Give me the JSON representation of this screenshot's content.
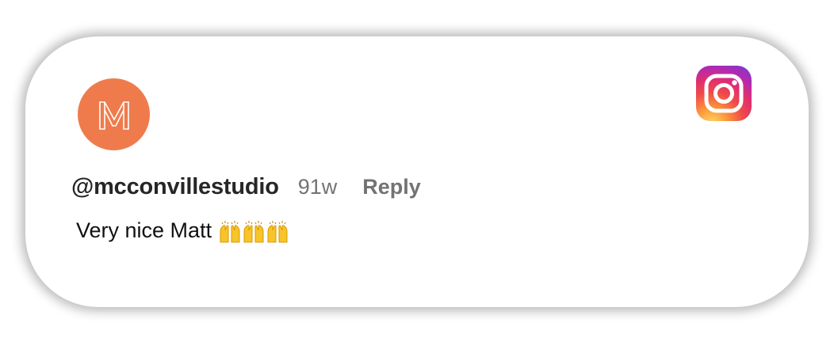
{
  "comment": {
    "username": "@mcconvillestudio",
    "age": "91w",
    "reply_label": "Reply",
    "text": "Very nice Matt",
    "emoji_count": 3,
    "emoji_name": "raising-hands"
  },
  "avatar": {
    "monogram": "M",
    "color": "#ef7b4c"
  },
  "brand": {
    "icon": "instagram-icon"
  }
}
